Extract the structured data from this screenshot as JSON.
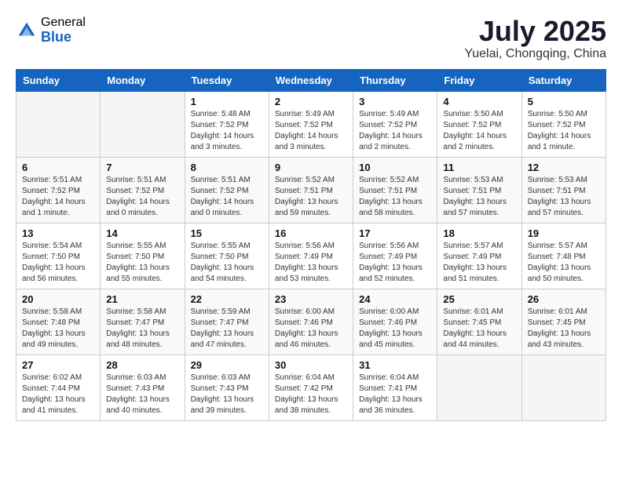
{
  "header": {
    "logo_general": "General",
    "logo_blue": "Blue",
    "month_title": "July 2025",
    "location": "Yuelai, Chongqing, China"
  },
  "weekdays": [
    "Sunday",
    "Monday",
    "Tuesday",
    "Wednesday",
    "Thursday",
    "Friday",
    "Saturday"
  ],
  "weeks": [
    [
      {
        "day": "",
        "content": ""
      },
      {
        "day": "",
        "content": ""
      },
      {
        "day": "1",
        "content": "Sunrise: 5:48 AM\nSunset: 7:52 PM\nDaylight: 14 hours\nand 3 minutes."
      },
      {
        "day": "2",
        "content": "Sunrise: 5:49 AM\nSunset: 7:52 PM\nDaylight: 14 hours\nand 3 minutes."
      },
      {
        "day": "3",
        "content": "Sunrise: 5:49 AM\nSunset: 7:52 PM\nDaylight: 14 hours\nand 2 minutes."
      },
      {
        "day": "4",
        "content": "Sunrise: 5:50 AM\nSunset: 7:52 PM\nDaylight: 14 hours\nand 2 minutes."
      },
      {
        "day": "5",
        "content": "Sunrise: 5:50 AM\nSunset: 7:52 PM\nDaylight: 14 hours\nand 1 minute."
      }
    ],
    [
      {
        "day": "6",
        "content": "Sunrise: 5:51 AM\nSunset: 7:52 PM\nDaylight: 14 hours\nand 1 minute."
      },
      {
        "day": "7",
        "content": "Sunrise: 5:51 AM\nSunset: 7:52 PM\nDaylight: 14 hours\nand 0 minutes."
      },
      {
        "day": "8",
        "content": "Sunrise: 5:51 AM\nSunset: 7:52 PM\nDaylight: 14 hours\nand 0 minutes."
      },
      {
        "day": "9",
        "content": "Sunrise: 5:52 AM\nSunset: 7:51 PM\nDaylight: 13 hours\nand 59 minutes."
      },
      {
        "day": "10",
        "content": "Sunrise: 5:52 AM\nSunset: 7:51 PM\nDaylight: 13 hours\nand 58 minutes."
      },
      {
        "day": "11",
        "content": "Sunrise: 5:53 AM\nSunset: 7:51 PM\nDaylight: 13 hours\nand 57 minutes."
      },
      {
        "day": "12",
        "content": "Sunrise: 5:53 AM\nSunset: 7:51 PM\nDaylight: 13 hours\nand 57 minutes."
      }
    ],
    [
      {
        "day": "13",
        "content": "Sunrise: 5:54 AM\nSunset: 7:50 PM\nDaylight: 13 hours\nand 56 minutes."
      },
      {
        "day": "14",
        "content": "Sunrise: 5:55 AM\nSunset: 7:50 PM\nDaylight: 13 hours\nand 55 minutes."
      },
      {
        "day": "15",
        "content": "Sunrise: 5:55 AM\nSunset: 7:50 PM\nDaylight: 13 hours\nand 54 minutes."
      },
      {
        "day": "16",
        "content": "Sunrise: 5:56 AM\nSunset: 7:49 PM\nDaylight: 13 hours\nand 53 minutes."
      },
      {
        "day": "17",
        "content": "Sunrise: 5:56 AM\nSunset: 7:49 PM\nDaylight: 13 hours\nand 52 minutes."
      },
      {
        "day": "18",
        "content": "Sunrise: 5:57 AM\nSunset: 7:49 PM\nDaylight: 13 hours\nand 51 minutes."
      },
      {
        "day": "19",
        "content": "Sunrise: 5:57 AM\nSunset: 7:48 PM\nDaylight: 13 hours\nand 50 minutes."
      }
    ],
    [
      {
        "day": "20",
        "content": "Sunrise: 5:58 AM\nSunset: 7:48 PM\nDaylight: 13 hours\nand 49 minutes."
      },
      {
        "day": "21",
        "content": "Sunrise: 5:58 AM\nSunset: 7:47 PM\nDaylight: 13 hours\nand 48 minutes."
      },
      {
        "day": "22",
        "content": "Sunrise: 5:59 AM\nSunset: 7:47 PM\nDaylight: 13 hours\nand 47 minutes."
      },
      {
        "day": "23",
        "content": "Sunrise: 6:00 AM\nSunset: 7:46 PM\nDaylight: 13 hours\nand 46 minutes."
      },
      {
        "day": "24",
        "content": "Sunrise: 6:00 AM\nSunset: 7:46 PM\nDaylight: 13 hours\nand 45 minutes."
      },
      {
        "day": "25",
        "content": "Sunrise: 6:01 AM\nSunset: 7:45 PM\nDaylight: 13 hours\nand 44 minutes."
      },
      {
        "day": "26",
        "content": "Sunrise: 6:01 AM\nSunset: 7:45 PM\nDaylight: 13 hours\nand 43 minutes."
      }
    ],
    [
      {
        "day": "27",
        "content": "Sunrise: 6:02 AM\nSunset: 7:44 PM\nDaylight: 13 hours\nand 41 minutes."
      },
      {
        "day": "28",
        "content": "Sunrise: 6:03 AM\nSunset: 7:43 PM\nDaylight: 13 hours\nand 40 minutes."
      },
      {
        "day": "29",
        "content": "Sunrise: 6:03 AM\nSunset: 7:43 PM\nDaylight: 13 hours\nand 39 minutes."
      },
      {
        "day": "30",
        "content": "Sunrise: 6:04 AM\nSunset: 7:42 PM\nDaylight: 13 hours\nand 38 minutes."
      },
      {
        "day": "31",
        "content": "Sunrise: 6:04 AM\nSunset: 7:41 PM\nDaylight: 13 hours\nand 36 minutes."
      },
      {
        "day": "",
        "content": ""
      },
      {
        "day": "",
        "content": ""
      }
    ]
  ]
}
